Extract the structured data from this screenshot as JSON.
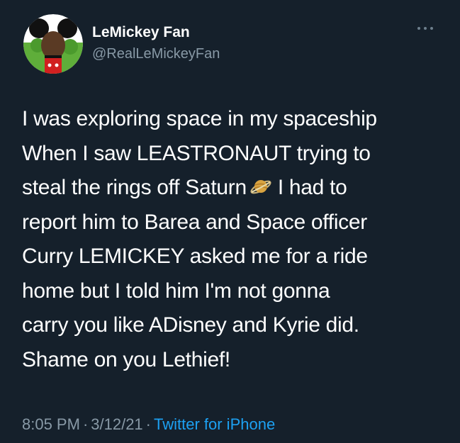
{
  "author": {
    "display_name": "LeMickey Fan",
    "handle": "@RealLeMickeyFan",
    "avatar_icon": "mickey-ears-avatar"
  },
  "menu": {
    "more_icon": "more-options-icon"
  },
  "tweet": {
    "lines": [
      "I was exploring space in my spaceship",
      "When I saw LEASTRONAUT trying to",
      "steal the rings off Saturn",
      "I had to",
      "report him to Barea and Space officer",
      "Curry LEMICKEY asked me for a ride",
      "home but I told him I'm not gonna",
      "carry you like ADisney and Kyrie did.",
      "Shame on you Lethief!"
    ],
    "emoji_icon": "ringed-planet-icon"
  },
  "meta": {
    "time": "8:05 PM",
    "separator": "·",
    "date": "3/12/21",
    "source": "Twitter for iPhone"
  },
  "colors": {
    "background": "#15202b",
    "text": "#ffffff",
    "secondary": "#8899a6",
    "link": "#1da1f2"
  }
}
